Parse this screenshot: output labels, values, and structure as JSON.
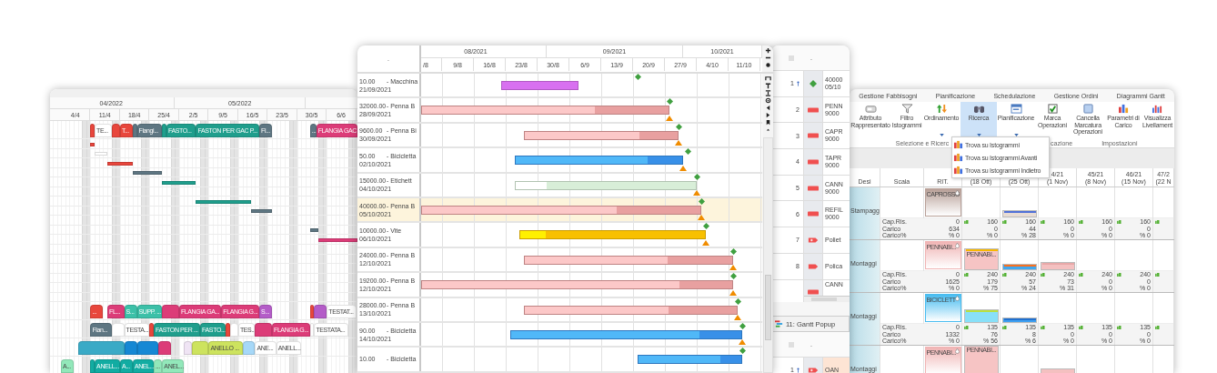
{
  "left_gantt": {
    "months": [
      "04/2022",
      "05/2022"
    ],
    "weeks": [
      "4/4",
      "11/4",
      "18/4",
      "25/4",
      "2/5",
      "9/5",
      "16/5",
      "23/5",
      "30/5",
      "6/6"
    ],
    "rows": [
      {
        "kind": "tall",
        "bars": [
          {
            "color": "#e8463c"
          },
          {
            "label": "TE...",
            "color": "#ffffff"
          },
          {
            "color": "#e8463c"
          },
          {
            "label": "T...",
            "color": "#e8463c"
          },
          {
            "color": "#5e7682"
          },
          {
            "label": "Flangi...",
            "color": "#5e7682"
          },
          {
            "color": "#1f9e8c"
          },
          {
            "label": "FASTO...",
            "color": "#1f9e8c"
          },
          {
            "label": "FASTON PER GAC P...",
            "color": "#1f9e8c"
          },
          {
            "label": "Fl...",
            "color": "#5e7682"
          },
          {
            "label": "...",
            "color": "#5e7682"
          },
          {
            "label": "FLANGIA GAC",
            "color": "#dc3c78"
          }
        ]
      },
      {
        "kind": "thin",
        "bars": [
          {
            "color": "#e8463c"
          }
        ]
      },
      {
        "kind": "thin",
        "bars": [
          {
            "color": "#ffffff"
          }
        ]
      },
      {
        "kind": "thin",
        "bars": [
          {
            "color": "#e8463c"
          }
        ]
      },
      {
        "kind": "thin",
        "bars": [
          {
            "color": "#5e7682"
          }
        ]
      },
      {
        "kind": "thin",
        "bars": [
          {
            "color": "#1f9e8c"
          }
        ]
      },
      {
        "kind": "thin"
      },
      {
        "kind": "thin",
        "bars": [
          {
            "color": "#1f9e8c"
          }
        ]
      },
      {
        "kind": "thin",
        "bars": [
          {
            "color": "#5e7682"
          }
        ]
      },
      {
        "kind": "thin"
      },
      {
        "kind": "thin",
        "bars": [
          {
            "color": "#5e7682"
          }
        ]
      },
      {
        "kind": "thin",
        "bars": [
          {
            "color": "#dc3c78"
          }
        ]
      },
      {
        "kind": "thin"
      },
      {
        "kind": "thin"
      },
      {
        "kind": "thin"
      },
      {
        "kind": "thin"
      },
      {
        "kind": "thin"
      },
      {
        "kind": "thin"
      },
      {
        "kind": "tall",
        "bars": [
          {
            "label": "...",
            "color": "#e8463c"
          },
          {
            "label": "FL...",
            "color": "#dc3c78"
          },
          {
            "label": "S...",
            "color": "#3cc0a8"
          },
          {
            "label": "SUPP. ...",
            "color": "#3cc0a8"
          },
          {
            "color": "#dc3c78"
          },
          {
            "label": "FLANGIA GA...",
            "color": "#dc3c78"
          },
          {
            "label": "FLANGIA G...",
            "color": "#dc3c78"
          },
          {
            "label": "S...",
            "color": "#b45cc8"
          },
          {
            "color": "#e8463c"
          },
          {
            "color": "#b45cc8"
          },
          {
            "label": "TESTAT...",
            "color": "#ffffff"
          }
        ]
      },
      {
        "kind": "tall",
        "bars": [
          {
            "label": "Flan...",
            "color": "#5e7682"
          },
          {
            "color": "#ffffff"
          },
          {
            "label": "TESTA...",
            "color": "#ffffff"
          },
          {
            "color": "#e8463c"
          },
          {
            "label": "FASTON PER ...",
            "color": "#1f9e8c"
          },
          {
            "label": "FASTO...",
            "color": "#1f9e8c"
          },
          {
            "color": "#e8463c"
          },
          {
            "color": "#ffffff"
          },
          {
            "label": "TES...",
            "color": "#ffffff"
          },
          {
            "color": "#dc3c78"
          },
          {
            "label": "FLANGIA G...",
            "color": "#dc3c78"
          },
          {
            "color": "#ffffff"
          },
          {
            "label": "TESTATA...",
            "color": "#ffffff"
          }
        ]
      },
      {
        "kind": "tall",
        "bars": [
          {
            "color": "#3aaac6"
          },
          {
            "color": "#1688d4"
          },
          {
            "color": "#1688d4"
          },
          {
            "color": "#dc3c78"
          },
          {
            "color": "#efe4f4"
          },
          {
            "color": "#cde35e"
          },
          {
            "label": "ANELLO ...",
            "color": "#cde35e"
          },
          {
            "color": "#a6d8f8"
          },
          {
            "label": "ANE...",
            "color": "#ffffff"
          },
          {
            "label": "ANELL...",
            "color": "#ffffff"
          }
        ]
      },
      {
        "kind": "tall",
        "bars": [
          {
            "label": "A...",
            "color": "#92e8ba"
          },
          {
            "color": "#12aca2"
          },
          {
            "label": "ANELL...",
            "color": "#12aca2"
          },
          {
            "label": "A...",
            "color": "#12aca2"
          },
          {
            "label": "ANEL...",
            "color": "#12aca2"
          },
          {
            "label": "...",
            "color": "#92e8ba"
          },
          {
            "label": "ANEL...",
            "color": "#92e8ba"
          }
        ]
      }
    ]
  },
  "order_gantt": {
    "header_mark": ".",
    "months": [
      "08/2021",
      "09/2021",
      "10/2021"
    ],
    "weeks": [
      "/8",
      "9/8",
      "16/8",
      "23/8",
      "30/8",
      "6/9",
      "13/9",
      "20/9",
      "27/9",
      "4/10",
      "11/10"
    ],
    "rows": [
      {
        "qty": "10.00",
        "item": "- Macchina",
        "date": "21/09/2021",
        "color": "#d870f0",
        "warning": false,
        "selected": false
      },
      {
        "qty": "32000.00",
        "item": "- Penna B",
        "date": "28/09/2021",
        "progress": {
          "level": 0.7,
          "color": "#fcc8c8"
        },
        "color": "#e8a0a0",
        "warning": true,
        "selected": false
      },
      {
        "qty": "9600.00",
        "item": "- Penna Bi",
        "date": "30/09/2021",
        "progress": {
          "level": 0.75,
          "color": "#fcc8c8"
        },
        "color": "#e8a0a0",
        "warning": true,
        "selected": false
      },
      {
        "qty": "50.00",
        "item": "- Bicicletta",
        "date": "02/10/2021",
        "progress": {
          "level": 0.79,
          "color": "#50b8f8"
        },
        "color": "#3890e8",
        "warning": true,
        "selected": false
      },
      {
        "qty": "15000.00",
        "item": "- Etichett",
        "date": "04/10/2021",
        "progress": {
          "level": 0.17,
          "color": "#ffffff"
        },
        "color": "#d8eed8",
        "warning": true,
        "selected": false
      },
      {
        "qty": "40000.00",
        "item": "- Penna B",
        "date": "05/10/2021",
        "progress": {
          "level": 0.7,
          "color": "#fcc8c8"
        },
        "color": "#e8a0a0",
        "warning": true,
        "selected": true
      },
      {
        "qty": "10000.00",
        "item": "- Vite",
        "date": "06/10/2021",
        "progress": {
          "level": 0.14,
          "color": "#fff000"
        },
        "color": "#f8c000",
        "warning": true,
        "selected": false
      },
      {
        "qty": "24000.00",
        "item": "- Penna B",
        "date": "12/10/2021",
        "progress": {
          "level": 0.69,
          "color": "#fcc8c8"
        },
        "color": "#e8a0a0",
        "warning": true,
        "selected": false
      },
      {
        "qty": "19200.00",
        "item": "- Penna B",
        "date": "12/10/2021",
        "progress": {
          "level": 0.83,
          "color": "#fcc8c8"
        },
        "color": "#e8a0a0",
        "warning": true,
        "selected": false
      },
      {
        "qty": "28000.00",
        "item": "- Penna B",
        "date": "13/10/2021",
        "progress": {
          "level": 0.68,
          "color": "#fcc8c8"
        },
        "color": "#e8a0a0",
        "warning": true,
        "selected": false
      },
      {
        "qty": "90.00",
        "item": "- Bicicletta",
        "date": "14/10/2021",
        "progress": {
          "level": 0.82,
          "color": "#50b8f8"
        },
        "color": "#3890e8",
        "warning": true,
        "selected": false
      },
      {
        "qty": "10.00",
        "item": "- Bicicletta",
        "progress": {
          "level": 0.8,
          "color": "#50b8f8"
        },
        "color": "#3890e8",
        "warning": false,
        "selected": false
      }
    ]
  },
  "operations_list": {
    "header_mark": ".",
    "rows": [
      {
        "number": "1",
        "pinned": true,
        "kind": "diamond",
        "text": [
          "40000",
          "05/10"
        ]
      },
      {
        "number": "2",
        "pinned": false,
        "kind": "bar",
        "text": [
          "PENN",
          "9000"
        ]
      },
      {
        "number": "3",
        "pinned": false,
        "kind": "bar",
        "text": [
          "CAPR",
          "9000"
        ]
      },
      {
        "number": "4",
        "pinned": false,
        "kind": "bar",
        "text": [
          "TAPR",
          "9000"
        ]
      },
      {
        "number": "5",
        "pinned": false,
        "kind": "bar",
        "text": [
          "CANN",
          "9000"
        ]
      },
      {
        "number": "6",
        "pinned": false,
        "kind": "bar",
        "text": [
          "REFIL",
          "9000"
        ]
      },
      {
        "number": "7",
        "pinned": false,
        "kind": "tag-plus",
        "text": [
          "Poliet"
        ]
      },
      {
        "number": "8",
        "pinned": false,
        "kind": "tag",
        "text": [
          "Polica"
        ]
      },
      {
        "pinned": false,
        "kind": "bar",
        "text": [
          "CANN"
        ]
      }
    ],
    "popup": {
      "title": "11: Gantt Popup",
      "header_mark": ".",
      "rows": [
        {
          "number": "1",
          "pinned": true,
          "kind": "tag-plus",
          "text": [
            "OAN"
          ]
        }
      ]
    }
  },
  "load_view": {
    "ribbon_tabs": [
      "Gestione Fabbisogni",
      "Pianificazione",
      "Schedulazione",
      "Gestione Ordini",
      "Diagrammi Gantt"
    ],
    "buttons": [
      {
        "lines": [
          "Attributo",
          "Rappresentato"
        ],
        "dropdown": false,
        "selected": false
      },
      {
        "lines": [
          "Filtro",
          "Istogrammi"
        ],
        "dropdown": false,
        "selected": false
      },
      {
        "lines": [
          "Ordinamento"
        ],
        "dropdown": true,
        "selected": false
      },
      {
        "lines": [
          "Ricerca"
        ],
        "dropdown": true,
        "selected": true
      },
      {
        "lines": [
          "Pianificazione"
        ],
        "dropdown": true,
        "selected": false
      },
      {
        "lines": [
          "Marca",
          "Operazioni"
        ],
        "dropdown": false,
        "selected": false
      },
      {
        "lines": [
          "Cancella",
          "Marcatura",
          "Operazioni"
        ],
        "dropdown": false,
        "selected": false
      },
      {
        "lines": [
          "Parametri di",
          "Carico"
        ],
        "dropdown": false,
        "selected": false
      },
      {
        "lines": [
          "Visualizza",
          "Livellament"
        ],
        "dropdown": false,
        "selected": false
      }
    ],
    "ribbon_groups": [
      "Selezione e Ricerc",
      "cazione",
      "Impostazioni"
    ],
    "menu": [
      "Trova su Istogrammi",
      "Trova su Istogrammi Avanti",
      "Trova su Istogrammi Indietro"
    ],
    "columns": [
      {
        "lines": [
          "Desi"
        ]
      },
      {
        "lines": [
          "Scala"
        ]
      },
      {
        "lines": [
          "RIT."
        ]
      },
      {
        "lines": [
          "(18 Ott)"
        ]
      },
      {
        "lines": [
          "(25 Ott)"
        ]
      },
      {
        "lines": [
          "4/21",
          "(1 Nov)"
        ]
      },
      {
        "lines": [
          "45/21",
          "(8 Nov)"
        ]
      },
      {
        "lines": [
          "46/21",
          "(15 Nov)"
        ]
      },
      {
        "lines": [
          "47/2",
          "(22 N"
        ]
      }
    ],
    "groups": [
      {
        "name": "Stampagg",
        "item": "CAPROSSO",
        "color": "#b8a098",
        "stat_labels": [
          "Cap.Ris.",
          "Carico",
          "Carico%"
        ],
        "rit": [
          "0",
          "634",
          "% 0"
        ],
        "weeks": [
          {
            "flag": true,
            "values": [
              "160",
              "0",
              "% 0"
            ]
          },
          {
            "flag": true,
            "values": [
              "160",
              "44",
              "% 28"
            ]
          },
          {
            "flag": true,
            "values": [
              "160",
              "0",
              "% 0"
            ]
          },
          {
            "flag": true,
            "values": [
              "160",
              "0",
              "% 0"
            ]
          },
          {
            "flag": true,
            "values": [
              "160",
              "0",
              "% 0"
            ]
          },
          {
            "flag": true
          }
        ],
        "bars": [
          {
            "color": "#e8dcd4",
            "cap": {
              "color": "#5070d8"
            }
          }
        ]
      },
      {
        "name": "Montaggi",
        "item": "PENNABI...",
        "color": "#f0b4b4",
        "stat_labels": [
          "Cap.Ris.",
          "Carico",
          "Carico%"
        ],
        "rit": [
          "0",
          "1625",
          "% 0"
        ],
        "weeks": [
          {
            "flag": true,
            "values": [
              "240",
              "179",
              "% 75"
            ]
          },
          {
            "flag": true,
            "values": [
              "240",
              "57",
              "% 24"
            ]
          },
          {
            "flag": true,
            "values": [
              "240",
              "73",
              "% 31"
            ]
          },
          {
            "flag": true,
            "values": [
              "240",
              "0",
              "% 0"
            ]
          },
          {
            "flag": true,
            "values": [
              "240",
              "0",
              "% 0"
            ]
          },
          {
            "flag": true
          }
        ],
        "bars": [
          {
            "color": "#f6c4c4",
            "cap": {
              "color": "#f8b800"
            },
            "label": "PENNABI..."
          },
          {
            "color": "#40a8f0",
            "cap": {
              "color": "#f87020"
            }
          },
          {
            "color": "#f4c0c0",
            "cap": {
              "color": "#e8a8a8"
            }
          }
        ]
      },
      {
        "name": "Montaggi",
        "item": "BICICLETT",
        "color": "#48bcf0",
        "stat_labels": [
          "Cap.Ris.",
          "Carico",
          "Carico%"
        ],
        "rit": [
          "0",
          "1332",
          "% 0"
        ],
        "weeks": [
          {
            "flag": true,
            "values": [
              "135",
              "76",
              "% 56"
            ]
          },
          {
            "flag": true,
            "values": [
              "135",
              "8",
              "% 6"
            ]
          },
          {
            "flag": true,
            "values": [
              "135",
              "0",
              "% 0"
            ]
          },
          {
            "flag": true,
            "values": [
              "135",
              "0",
              "% 0"
            ]
          },
          {
            "flag": true,
            "values": [
              "135",
              "0",
              "% 0"
            ]
          },
          {
            "flag": true
          }
        ],
        "bars": [
          {
            "color": "#88e0f8",
            "cap": {
              "color": "#b8e040"
            }
          },
          {
            "color": "#40a0f0",
            "cap": {
              "color": "#2070d0"
            }
          }
        ]
      },
      {
        "name": "Montaggi",
        "item": "PENNABI...",
        "color": "#f0b4b4",
        "bars": [
          {
            "color": "#f6c4c4",
            "label": "PENNABI..."
          },
          {
            "color": "#f4c0c0"
          }
        ]
      }
    ]
  }
}
